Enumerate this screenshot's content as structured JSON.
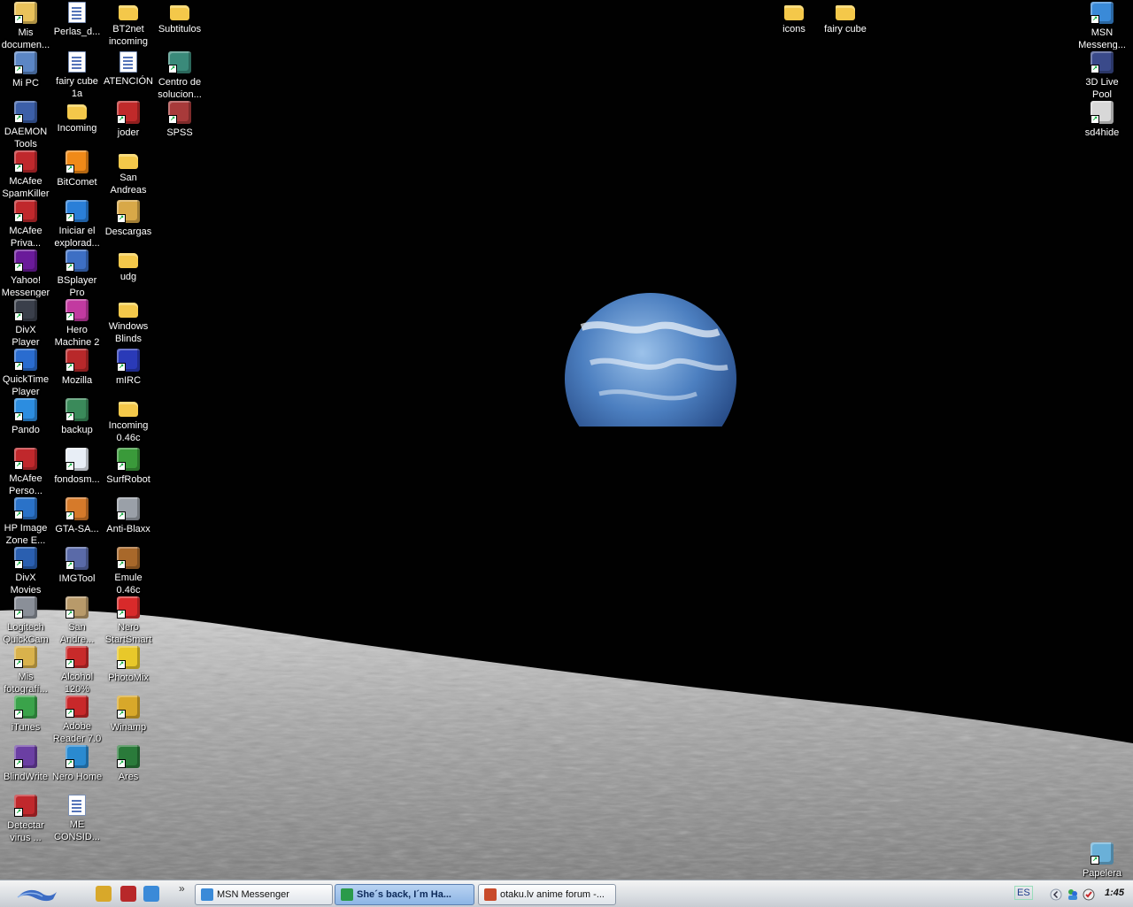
{
  "desktop": {
    "icons": [
      {
        "label": "Mis\ndocumen...",
        "kind": "folder-doc",
        "color": "#e9c25b"
      },
      {
        "label": "Mi PC",
        "kind": "app",
        "color": "#5b86c5"
      },
      {
        "label": "DAEMON\nTools",
        "kind": "app",
        "color": "#3c5fa8"
      },
      {
        "label": "McAfee\nSpamKiller",
        "kind": "app",
        "color": "#c0282c"
      },
      {
        "label": "McAfee\nPriva...",
        "kind": "app",
        "color": "#c0282c"
      },
      {
        "label": "Yahoo!\nMessenger",
        "kind": "app",
        "color": "#6a1a9a"
      },
      {
        "label": "DivX\nPlayer",
        "kind": "app",
        "color": "#3a3f4a"
      },
      {
        "label": "QuickTime\nPlayer",
        "kind": "app",
        "color": "#2a6ccf"
      },
      {
        "label": "Pando",
        "kind": "app",
        "color": "#2c8de0"
      },
      {
        "label": "McAfee\nPerso...",
        "kind": "app",
        "color": "#c0282c"
      },
      {
        "label": "HP Image\nZone E...",
        "kind": "app",
        "color": "#2a72c8"
      },
      {
        "label": "DivX\nMovies",
        "kind": "app",
        "color": "#2a5fb0"
      },
      {
        "label": "Logitech\nQuickCam",
        "kind": "app",
        "color": "#8a8f98"
      },
      {
        "label": "Mis\nfotografí...",
        "kind": "app",
        "color": "#d9b24c"
      },
      {
        "label": "iTunes",
        "kind": "app",
        "color": "#3aa34a"
      },
      {
        "label": "BlindWrite",
        "kind": "app",
        "color": "#6b3fa3"
      },
      {
        "label": "Detectar\nvirus ...",
        "kind": "app",
        "color": "#c0282c"
      },
      {
        "label": "Perlas_d...",
        "kind": "doc",
        "color": "#ffffff"
      },
      {
        "label": "fairy cube\n1a",
        "kind": "doc",
        "color": "#ffffff"
      },
      {
        "label": "Incoming",
        "kind": "folder",
        "color": "#f4c84a"
      },
      {
        "label": "BitComet",
        "kind": "app",
        "color": "#f08a18"
      },
      {
        "label": "Iniciar el\nexplorad...",
        "kind": "app",
        "color": "#2a7fd8"
      },
      {
        "label": "BSplayer\nPro",
        "kind": "app",
        "color": "#3d6fc4"
      },
      {
        "label": "Hero\nMachine 2",
        "kind": "app",
        "color": "#c23aa0"
      },
      {
        "label": "Mozilla",
        "kind": "app",
        "color": "#b8282a"
      },
      {
        "label": "backup",
        "kind": "app",
        "color": "#3a8a5a"
      },
      {
        "label": "fondosm...",
        "kind": "app",
        "color": "#e8eef6"
      },
      {
        "label": "GTA-SA...",
        "kind": "app",
        "color": "#d67a2a"
      },
      {
        "label": "IMGTool",
        "kind": "app",
        "color": "#5a6aa8"
      },
      {
        "label": "San\nAndre...",
        "kind": "app",
        "color": "#b89a6a"
      },
      {
        "label": "Alcohol\n120%",
        "kind": "app",
        "color": "#c82a2a"
      },
      {
        "label": "Adobe\nReader 7.0",
        "kind": "app",
        "color": "#c8282a"
      },
      {
        "label": "Nero Home",
        "kind": "app",
        "color": "#2a8ad0"
      },
      {
        "label": "ME\nCONSID...",
        "kind": "doc",
        "color": "#ffffff"
      },
      {
        "label": "BT2net\nincoming",
        "kind": "folder",
        "color": "#f4c84a"
      },
      {
        "label": "ATENCIÓN",
        "kind": "doc",
        "color": "#ffffff"
      },
      {
        "label": "joder",
        "kind": "app",
        "color": "#c02a2a"
      },
      {
        "label": "San\nAndreas",
        "kind": "folder",
        "color": "#f4c84a"
      },
      {
        "label": "Descargas",
        "kind": "app",
        "color": "#d8a848"
      },
      {
        "label": "udg",
        "kind": "folder",
        "color": "#f4c84a"
      },
      {
        "label": "Windows\nBlinds",
        "kind": "folder",
        "color": "#f4c84a"
      },
      {
        "label": "mIRC",
        "kind": "app",
        "color": "#2a3ab8"
      },
      {
        "label": "Incoming\n0.46c",
        "kind": "folder",
        "color": "#f4c84a"
      },
      {
        "label": "SurfRobot",
        "kind": "app",
        "color": "#3a9a3a"
      },
      {
        "label": "Anti-Blaxx",
        "kind": "app",
        "color": "#9aa0a8"
      },
      {
        "label": "Emule\n0.46c",
        "kind": "app",
        "color": "#a8682a"
      },
      {
        "label": "Nero\nStartSmart",
        "kind": "app",
        "color": "#d82a2a"
      },
      {
        "label": "PhotoMix",
        "kind": "app",
        "color": "#e8c82a"
      },
      {
        "label": "Winamp",
        "kind": "app",
        "color": "#d8a82a"
      },
      {
        "label": "Ares",
        "kind": "app",
        "color": "#2a7a3a"
      },
      {
        "label": "Subtitulos",
        "kind": "folder",
        "color": "#f4c84a"
      },
      {
        "label": "Centro de\nsolucion...",
        "kind": "app",
        "color": "#3a8a7a"
      },
      {
        "label": "SPSS",
        "kind": "app",
        "color": "#a83a3a"
      },
      {
        "label": "icons",
        "kind": "folder",
        "color": "#f4c84a"
      },
      {
        "label": "fairy cube",
        "kind": "folder",
        "color": "#f4c84a"
      },
      {
        "label": "MSN\nMesseng...",
        "kind": "app",
        "color": "#3a8ad8"
      },
      {
        "label": "3D Live\nPool",
        "kind": "app",
        "color": "#3a4a8a"
      },
      {
        "label": "sd4hide",
        "kind": "app",
        "color": "#d8d8d8"
      },
      {
        "label": "Papelera\nde reciclaje",
        "kind": "app",
        "color": "#6ab0d8"
      }
    ]
  },
  "taskbar": {
    "start_icon": "xp-wave-icon",
    "quick_launch": [
      {
        "icon": "winamp-icon",
        "color": "#d8a82a"
      },
      {
        "icon": "mozilla-icon",
        "color": "#b8282a"
      },
      {
        "icon": "msn-icon",
        "color": "#3a8ad8"
      }
    ],
    "chevron": "»",
    "tasks": [
      {
        "label": "MSN Messenger",
        "color": "#3a8ad8",
        "active": false
      },
      {
        "label": "She´s back, I´m Ha...",
        "color": "#2a9a4a",
        "active": true
      },
      {
        "label": "otaku.lv anime forum -...",
        "color": "#c84a2a",
        "active": false
      }
    ],
    "tray": {
      "language": "ES",
      "clock": "1:45"
    }
  }
}
